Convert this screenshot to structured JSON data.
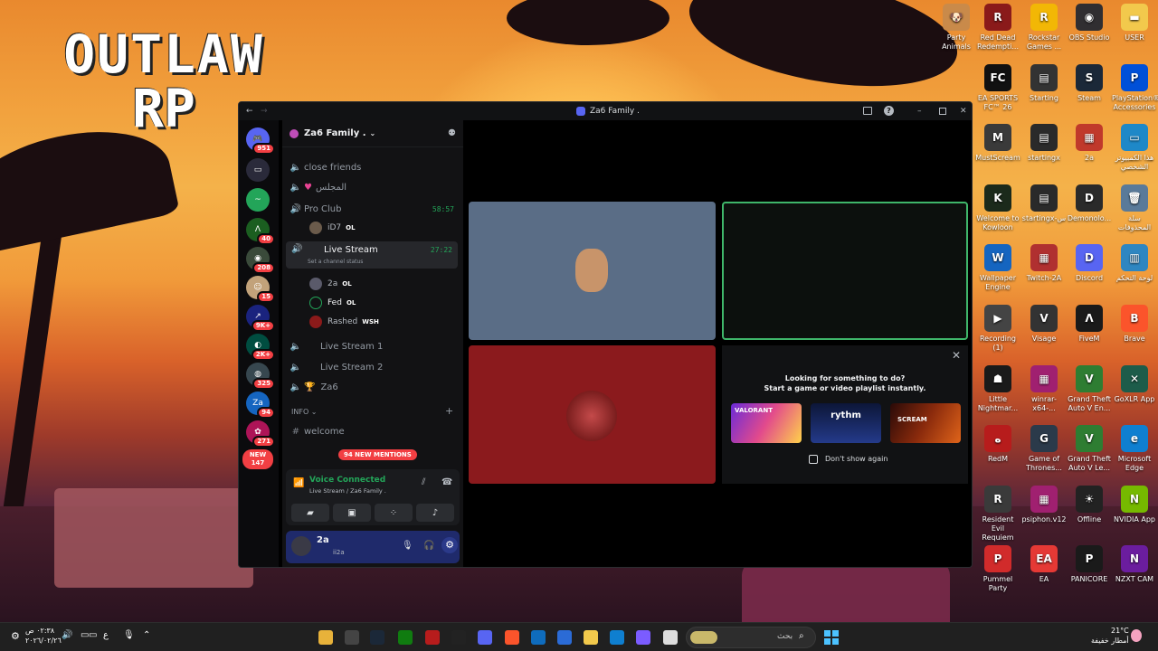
{
  "wallpaper": {
    "logo_line1": "OUTLAW",
    "logo_line2": "RP"
  },
  "desktop_icons": [
    {
      "label": "Party Animals",
      "color": "#c98a4a",
      "glyph": "🐶"
    },
    {
      "label": "Red Dead Redempti...",
      "color": "#8a1a1a",
      "glyph": "R"
    },
    {
      "label": "Rockstar Games ...",
      "color": "#f2b705",
      "glyph": "R"
    },
    {
      "label": "OBS Studio",
      "color": "#302e31",
      "glyph": "◉"
    },
    {
      "label": "USER",
      "color": "#f2c94c",
      "glyph": "▬"
    },
    {
      "label": "EA SPORTS FC™ 26",
      "color": "#111111",
      "glyph": "FC"
    },
    {
      "label": "Starting",
      "color": "#333333",
      "glyph": "▤"
    },
    {
      "label": "Steam",
      "color": "#1b2838",
      "glyph": "S"
    },
    {
      "label": "PlayStation® Accessories",
      "color": "#0050d8",
      "glyph": "P"
    },
    {
      "label": "MustScream",
      "color": "#3a3a3a",
      "glyph": "M"
    },
    {
      "label": "startingx",
      "color": "#2a2a2a",
      "glyph": "▤"
    },
    {
      "label": "2a",
      "color": "#c0392b",
      "glyph": "▦"
    },
    {
      "label": "هذا الكمبيوتر الشخصي",
      "color": "#1e88c8",
      "glyph": "▭"
    },
    {
      "label": "Welcome to Kowloon",
      "color": "#1b2a1b",
      "glyph": "K"
    },
    {
      "label": "startingx-س",
      "color": "#2a2a2a",
      "glyph": "▤"
    },
    {
      "label": "Demonolo...",
      "color": "#2a2a2a",
      "glyph": "D"
    },
    {
      "label": "سلة المحذوفات",
      "color": "#5a7a99",
      "glyph": "🗑"
    },
    {
      "label": "Wallpaper Engine",
      "color": "#1565c0",
      "glyph": "W"
    },
    {
      "label": "Twitch-2A",
      "color": "#b03030",
      "glyph": "▦"
    },
    {
      "label": "Discord",
      "color": "#5865f2",
      "glyph": "D"
    },
    {
      "label": "لوحة التحكم",
      "color": "#2e86c1",
      "glyph": "▥"
    },
    {
      "label": "Recording (1)",
      "color": "#444444",
      "glyph": "▶"
    },
    {
      "label": "Visage",
      "color": "#333333",
      "glyph": "V"
    },
    {
      "label": "FiveM",
      "color": "#1a1a1a",
      "glyph": "Λ"
    },
    {
      "label": "Brave",
      "color": "#fb542b",
      "glyph": "B"
    },
    {
      "label": "Little Nightmar...",
      "color": "#1a1a1a",
      "glyph": "☗"
    },
    {
      "label": "winrar-x64-...",
      "color": "#a02070",
      "glyph": "▦"
    },
    {
      "label": "Grand Theft Auto V En...",
      "color": "#2e7d32",
      "glyph": "V"
    },
    {
      "label": "GoXLR App",
      "color": "#1d5c4a",
      "glyph": "✕"
    },
    {
      "label": "RedM",
      "color": "#b71c1c",
      "glyph": "ه"
    },
    {
      "label": "Game of Thrones...",
      "color": "#2b3a4a",
      "glyph": "G"
    },
    {
      "label": "Grand Theft Auto V Le...",
      "color": "#2e7d32",
      "glyph": "V"
    },
    {
      "label": "Microsoft Edge",
      "color": "#0f7fd0",
      "glyph": "e"
    },
    {
      "label": "Resident Evil Requiem",
      "color": "#3a3a3a",
      "glyph": "R"
    },
    {
      "label": "psiphon.v12",
      "color": "#a02070",
      "glyph": "▦"
    },
    {
      "label": "Offline",
      "color": "#222222",
      "glyph": "☀"
    },
    {
      "label": "NVIDIA App",
      "color": "#76b900",
      "glyph": "N"
    },
    {
      "label": "Pummel Party",
      "color": "#d12b2b",
      "glyph": "P"
    },
    {
      "label": "EA",
      "color": "#e53935",
      "glyph": "EA"
    },
    {
      "label": "PANICORE",
      "color": "#1a1a1a",
      "glyph": "P"
    },
    {
      "label": "NZXT CAM",
      "color": "#6b1d9e",
      "glyph": "N"
    }
  ],
  "window": {
    "title": "Za6 Family ."
  },
  "servers": [
    {
      "badge": "951",
      "color": "#5865f2",
      "glyph": "🎮"
    },
    {
      "badge": "",
      "color": "#2a2a3a",
      "glyph": "▭"
    },
    {
      "badge": "",
      "color": "#23a559",
      "glyph": "~"
    },
    {
      "badge": "40",
      "color": "#1b5e20",
      "glyph": "Λ"
    },
    {
      "badge": "208",
      "color": "#3a4a3a",
      "glyph": "◉"
    },
    {
      "badge": "15",
      "color": "#c2a27a",
      "glyph": "☺"
    },
    {
      "badge": "9K+",
      "color": "#1a237e",
      "glyph": "↗"
    },
    {
      "badge": "2K+",
      "color": "#004d40",
      "glyph": "◐"
    },
    {
      "badge": "325",
      "color": "#37474f",
      "glyph": "◍"
    },
    {
      "badge": "94",
      "color": "#1565c0",
      "glyph": "Za"
    },
    {
      "badge": "271",
      "color": "#ad1457",
      "glyph": "✿"
    }
  ],
  "new_badge": {
    "line1": "NEW",
    "line2": "147"
  },
  "server_header": {
    "name": "Za6 Family ."
  },
  "channels": [
    {
      "label": "close friends"
    },
    {
      "label": "المجلس"
    },
    {
      "label": "Pro Club",
      "time": "58:57"
    },
    {
      "label": "Live Stream",
      "time": "27:22",
      "status": "Set a channel status"
    },
    {
      "label": "Live Stream 1"
    },
    {
      "label": "Live Stream 2"
    },
    {
      "label": "Za6"
    }
  ],
  "pro_club_users": [
    {
      "name": "iD7",
      "tag": "OL"
    }
  ],
  "live_stream_users": [
    {
      "name": "2a",
      "tag": "OL"
    },
    {
      "name": "Fed",
      "tag": "OL"
    },
    {
      "name": "Rashed",
      "tag": "WSH"
    }
  ],
  "info_category": "INFO",
  "welcome_channel": "welcome",
  "mentions_pill": "94 NEW MENTIONS",
  "voice": {
    "status": "Voice Connected",
    "location": "Live Stream / Za6 Family ."
  },
  "me": {
    "name": "2a",
    "sub": "ii2a"
  },
  "activity": {
    "title": "Looking for something to do?",
    "subtitle": "Start a game or video playlist instantly.",
    "dont_show": "Don't show again",
    "cards": [
      "VALORANT",
      "rythm",
      "SCREAM"
    ]
  },
  "taskbar": {
    "search_placeholder": "بحث",
    "time": "٠٢:٣٨ ص",
    "date": "٢٠٢٦/٠٢/٢٦",
    "weather_temp": "21°C",
    "weather_desc": "أمطار خفيفة",
    "lang": "ع"
  }
}
